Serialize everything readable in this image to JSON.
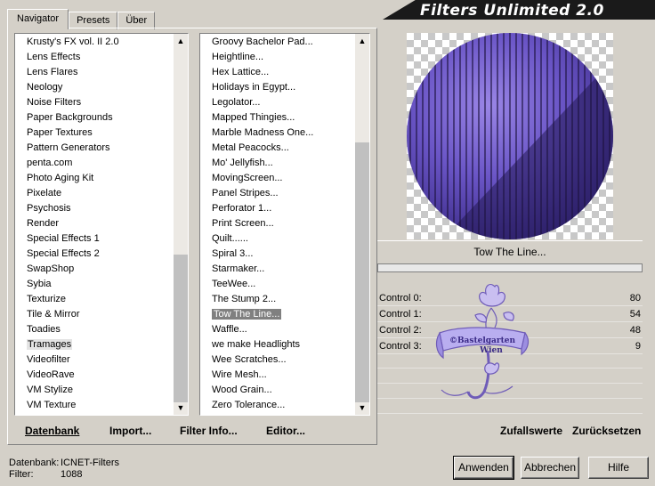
{
  "tabs": [
    "Navigator",
    "Presets",
    "Über"
  ],
  "title": "Filters Unlimited 2.0",
  "categories": [
    "Krusty's FX vol. II 2.0",
    "Lens Effects",
    "Lens Flares",
    "Neology",
    "Noise Filters",
    "Paper Backgrounds",
    "Paper Textures",
    "Pattern Generators",
    "penta.com",
    "Photo Aging Kit",
    "Pixelate",
    "Psychosis",
    "Render",
    "Special Effects 1",
    "Special Effects 2",
    "SwapShop",
    "Sybia",
    "Texturize",
    "Tile & Mirror",
    "Toadies",
    "Tramages",
    "Videofilter",
    "VideoRave",
    "VM Stylize",
    "VM Texture"
  ],
  "filters": [
    "Groovy Bachelor Pad...",
    "Heightline...",
    "Hex Lattice...",
    "Holidays in Egypt...",
    "Legolator...",
    "Mapped Thingies...",
    "Marble Madness One...",
    "Metal Peacocks...",
    "Mo' Jellyfish...",
    "MovingScreen...",
    "Panel Stripes...",
    "Perforator 1...",
    "Print Screen...",
    "Quilt......",
    "Spiral 3...",
    "Starmaker...",
    "TeeWee...",
    "The Stump 2...",
    "Tow The Line...",
    "Waffle...",
    "we make Headlights",
    "Wee Scratches...",
    "Wire Mesh...",
    "Wood Grain...",
    "Zero Tolerance..."
  ],
  "selected_category": "Tramages",
  "selected_filter": "Tow The Line...",
  "bottom_buttons": {
    "datenbank": "Datenbank",
    "import": "Import...",
    "filter_info": "Filter Info...",
    "editor": "Editor...",
    "zufallswerte": "Zufallswerte",
    "zuruecksetzen": "Zurücksetzen"
  },
  "filter_name": "Tow The Line...",
  "controls": [
    {
      "label": "Control 0:",
      "value": "80"
    },
    {
      "label": "Control 1:",
      "value": "54"
    },
    {
      "label": "Control 2:",
      "value": "48"
    },
    {
      "label": "Control 3:",
      "value": "9"
    }
  ],
  "status": {
    "datenbank_label": "Datenbank:",
    "datenbank_value": "ICNET-Filters",
    "filter_label": "Filter:",
    "filter_value": "1088"
  },
  "dialog_buttons": {
    "apply": "Anwenden",
    "cancel": "Abbrechen",
    "help": "Hilfe"
  },
  "watermark_text": "©Bastelgarten Wien",
  "colors": {
    "preview_purple": "#6a55c6",
    "preview_dark": "#241a56",
    "selection": "#808080",
    "window_bg": "#d4d0c8",
    "logo_lilac": "#8a75c6"
  }
}
